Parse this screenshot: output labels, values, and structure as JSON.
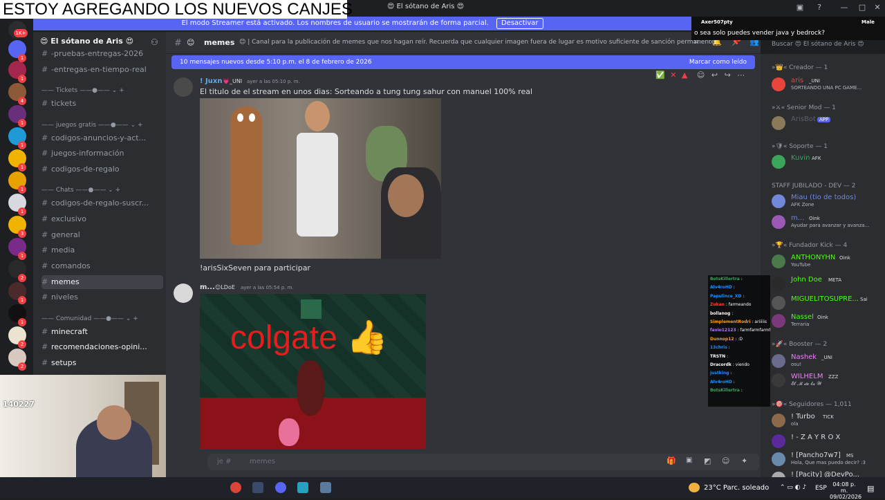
{
  "overlay_title": "ESTOY AGREGANDO LOS NUEVOS CANJES",
  "window": {
    "title": "😍 El sótano de Aris 😍"
  },
  "streamer_banner": {
    "text": "El modo Streamer está activado. Los nombres de usuario se mostrarán de forma parcial.",
    "button": "Desactivar"
  },
  "top_chat": {
    "user": "Axer507pty",
    "right_user": "Male",
    "message": "o sea solo puedes vender java y bedrock?"
  },
  "server_rail": {
    "top_badge": "1K+",
    "badges": [
      "1",
      "1",
      "4",
      "1",
      "1",
      "1",
      "1",
      "1",
      "3",
      "1",
      "2",
      "1",
      "1",
      "2",
      "2"
    ]
  },
  "sidebar": {
    "server_name": "😍 El sótano de Aris 😍",
    "items": [
      {
        "label": "-pruebas-entregas-2026",
        "type": "channel"
      },
      {
        "label": "-entregas-en-tiempo-real",
        "type": "channel"
      },
      {
        "label": "Tickets",
        "type": "category"
      },
      {
        "label": "tickets",
        "type": "channel"
      },
      {
        "label": "juegos gratis",
        "type": "category"
      },
      {
        "label": "codigos-anuncios-y-act...",
        "type": "channel"
      },
      {
        "label": "juegos-información",
        "type": "channel"
      },
      {
        "label": "codigos-de-regalo",
        "type": "channel"
      },
      {
        "label": "Chats",
        "type": "category"
      },
      {
        "label": "codigos-de-regalo-suscr...",
        "type": "channel"
      },
      {
        "label": "exclusivo",
        "type": "channel"
      },
      {
        "label": "general",
        "type": "channel"
      },
      {
        "label": "media",
        "type": "channel"
      },
      {
        "label": "comandos",
        "type": "channel"
      },
      {
        "label": "memes",
        "type": "channel",
        "selected": true
      },
      {
        "label": "niveles",
        "type": "channel"
      },
      {
        "label": "Comunidad",
        "type": "category"
      },
      {
        "label": "minecraft",
        "type": "channel"
      },
      {
        "label": "recomendaciones-opini...",
        "type": "channel"
      },
      {
        "label": "setups",
        "type": "channel"
      }
    ]
  },
  "webcam": {
    "counter": "140227"
  },
  "header": {
    "channel": "memes",
    "topic": "Canal para la publicación de memes que nos hagan reír. Recuerda que cualquier imagen fuera de lugar es motivo suficiente de sanción permanente.",
    "search_placeholder": "Buscar 😍 El sótano de Aris 😍"
  },
  "new_messages_bar": {
    "text": "10 mensajes nuevos desde 5:10 p.m. el 8 de febrero de 2026",
    "action": "Marcar como leído"
  },
  "messages": [
    {
      "author": "! Juxn",
      "tag": "_UNI",
      "time": "ayer a las 05:10 p. m.",
      "text": "El titulo de el stream en unos dias: Sorteando a tung tung sahur con manuel 100% real",
      "after_text": "!arisSixSeven para participar"
    },
    {
      "author": "m...",
      "tag": "LDoE",
      "time": "ayer a las 05:54 p. m.",
      "image_text": "colgate 👍"
    }
  ],
  "composer": {
    "placeholder": "memes",
    "prefix": "je #"
  },
  "members": {
    "groups": [
      {
        "header": "Creador — 1",
        "members": [
          {
            "name": "aris",
            "tag": "_UNI",
            "status": "SORTEANDO UNA PC GAME...",
            "color": "#e8453c"
          }
        ]
      },
      {
        "header": "Senior Mod — 1",
        "members": [
          {
            "name": "ArisBot",
            "tag": "APP",
            "status": "",
            "color": "#5d5f64"
          }
        ]
      },
      {
        "header": "Soporte — 1",
        "members": [
          {
            "name": "Kuvin",
            "tag": "AFK",
            "status": "",
            "color": "#3ba55c"
          }
        ]
      },
      {
        "header": "STAFF JUBILADO - DEV — 2",
        "members": [
          {
            "name": "Miau (tio de todos)",
            "tag": "",
            "status": "AFK Zone",
            "color": "#7289da"
          },
          {
            "name": "m...",
            "tag": "Oink",
            "status": "Ayudar para avanzar y avanza...",
            "color": "#7289da"
          }
        ]
      },
      {
        "header": "Fundador Kick — 4",
        "members": [
          {
            "name": "ANTHONYHN",
            "tag": "Oink",
            "status": "YouTube",
            "color": "#53fc18"
          },
          {
            "name": "John Doe",
            "tag": "META",
            "status": "",
            "color": "#53fc18"
          },
          {
            "name": "MIGUELITOSUPRE...",
            "tag": "Sai",
            "status": "",
            "color": "#53fc18"
          },
          {
            "name": "Nassel",
            "tag": "Oink",
            "status": "Terraria",
            "color": "#53fc18"
          }
        ]
      },
      {
        "header": "Booster — 2",
        "members": [
          {
            "name": "Nashek",
            "tag": "_UNI",
            "status": "osu!",
            "color": "#f47fff"
          },
          {
            "name": "WILHELM",
            "tag": "ZZZ",
            "status": "𝓔𝓵 𝓜 𝓭𝓮 𝓵𝓪 𝓦",
            "color": "#f47fff"
          }
        ]
      },
      {
        "header": "Seguidores — 1,011",
        "members": [
          {
            "name": "! Turbo",
            "tag": "TICK",
            "status": "ola",
            "color": "#dbdee1"
          },
          {
            "name": "! - Z A Y R O X",
            "tag": "",
            "status": "",
            "color": "#dbdee1"
          },
          {
            "name": "! [Pancho7w7]",
            "tag": "MS",
            "status": "Hola, Que mas puedo decir? :3",
            "color": "#dbdee1"
          },
          {
            "name": "! [Pacity] @DevPo...",
            "tag": "",
            "status": "",
            "color": "#dbdee1"
          }
        ]
      }
    ]
  },
  "twitch_chat": [
    {
      "user": "BotsKillertra",
      "msg": "",
      "color": "#3ba55c"
    },
    {
      "user": "Alv4roHD",
      "msg": "",
      "color": "#1e90ff"
    },
    {
      "user": "Papulince_XD",
      "msg": "",
      "color": "#1e90ff"
    },
    {
      "user": "Zukan",
      "msg": "farmeando",
      "color": "#ff3b3b"
    },
    {
      "user": "bollanog",
      "msg": "",
      "color": "#ffffff"
    },
    {
      "user": "SimplementRodri",
      "msg": "ariiiiis",
      "color": "#ff9f1a"
    },
    {
      "user": "favio12123",
      "msg": "farmfarmfarmfarm",
      "color": "#b57cff"
    },
    {
      "user": "Dunnop12",
      "msg": ":D",
      "color": "#ff9f1a"
    },
    {
      "user": "13chris",
      "msg": "",
      "color": "#1e90ff"
    },
    {
      "user": "TRSTN",
      "msg": "",
      "color": "#ffffff"
    },
    {
      "user": "Dracordk",
      "msg": "viendo",
      "color": "#ffffff"
    },
    {
      "user": "justking",
      "msg": "",
      "color": "#1e90ff"
    },
    {
      "user": "Alv4roHD",
      "msg": "",
      "color": "#1e90ff"
    },
    {
      "user": "BotsKillertra",
      "msg": "",
      "color": "#3ba55c"
    }
  ],
  "taskbar": {
    "weather": "23°C  Parc. soleado",
    "lang": "ESP",
    "time": "04:08 p. m.",
    "date": "09/02/2026"
  },
  "colors": {
    "accent": "#5865f2",
    "bg": "#313338",
    "sidebar": "#2b2d31",
    "rail": "#1e1f22"
  }
}
